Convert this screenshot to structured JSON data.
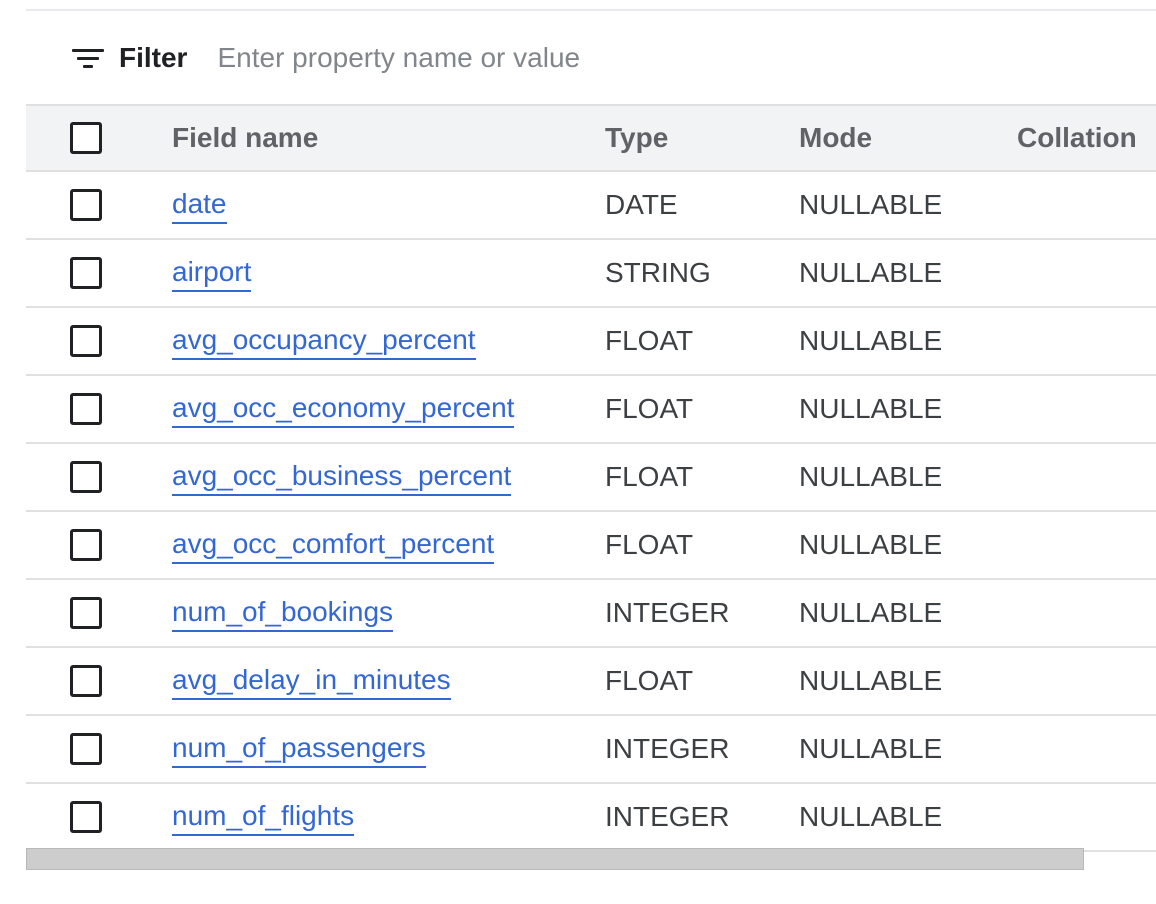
{
  "filter": {
    "icon": "filter-icon",
    "label": "Filter",
    "placeholder": "Enter property name or value",
    "value": ""
  },
  "table": {
    "headers": {
      "field_name": "Field name",
      "type": "Type",
      "mode": "Mode",
      "collation": "Collation"
    },
    "rows": [
      {
        "name": "date",
        "type": "DATE",
        "mode": "NULLABLE",
        "collation": ""
      },
      {
        "name": "airport",
        "type": "STRING",
        "mode": "NULLABLE",
        "collation": ""
      },
      {
        "name": "avg_occupancy_percent",
        "type": "FLOAT",
        "mode": "NULLABLE",
        "collation": ""
      },
      {
        "name": "avg_occ_economy_percent",
        "type": "FLOAT",
        "mode": "NULLABLE",
        "collation": ""
      },
      {
        "name": "avg_occ_business_percent",
        "type": "FLOAT",
        "mode": "NULLABLE",
        "collation": ""
      },
      {
        "name": "avg_occ_comfort_percent",
        "type": "FLOAT",
        "mode": "NULLABLE",
        "collation": ""
      },
      {
        "name": "num_of_bookings",
        "type": "INTEGER",
        "mode": "NULLABLE",
        "collation": ""
      },
      {
        "name": "avg_delay_in_minutes",
        "type": "FLOAT",
        "mode": "NULLABLE",
        "collation": ""
      },
      {
        "name": "num_of_passengers",
        "type": "INTEGER",
        "mode": "NULLABLE",
        "collation": ""
      },
      {
        "name": "num_of_flights",
        "type": "INTEGER",
        "mode": "NULLABLE",
        "collation": ""
      }
    ]
  },
  "colors": {
    "link": "#3367d6",
    "header_background": "#f1f3f4",
    "divider": "#e0e0e0",
    "text": "#202124"
  }
}
